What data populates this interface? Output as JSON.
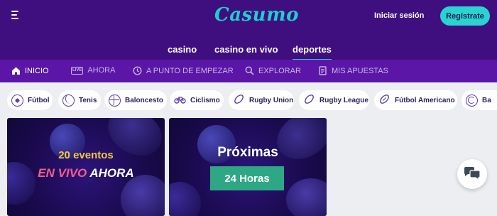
{
  "header": {
    "logo": "Casumo",
    "login_label": "Iniciar sesión",
    "register_label": "Regístrate"
  },
  "main_tabs": [
    {
      "label": "casino",
      "active": false
    },
    {
      "label": "casino en vivo",
      "active": false
    },
    {
      "label": "deportes",
      "active": true
    }
  ],
  "subnav": [
    {
      "label": "INICIO",
      "icon": "home-icon",
      "active": true
    },
    {
      "label": "AHORA",
      "icon": "live-icon",
      "active": false
    },
    {
      "label": "A PUNTO DE EMPEZAR",
      "icon": "clock-icon",
      "active": false
    },
    {
      "label": "EXPLORAR",
      "icon": "search-icon",
      "active": false
    },
    {
      "label": "MIS APUESTAS",
      "icon": "betslip-icon",
      "active": false
    }
  ],
  "subnav_live_badge": "LIVE",
  "sports": [
    {
      "label": "Fútbol",
      "icon": "soccer-ball-icon"
    },
    {
      "label": "Tenis",
      "icon": "tennis-ball-icon"
    },
    {
      "label": "Baloncesto",
      "icon": "basketball-icon"
    },
    {
      "label": "Ciclismo",
      "icon": "bicycle-icon"
    },
    {
      "label": "Rugby Union",
      "icon": "rugby-ball-icon"
    },
    {
      "label": "Rugby League",
      "icon": "rugby-ball-icon"
    },
    {
      "label": "Fútbol Americano",
      "icon": "american-football-icon"
    },
    {
      "label": "Ba",
      "icon": "volleyball-icon"
    }
  ],
  "cards": {
    "live": {
      "line1": "20 eventos",
      "line2a": "EN VIVO",
      "line2b": "AHORA"
    },
    "upcoming": {
      "line1": "Próximas",
      "badge": "24 Horas"
    }
  },
  "colors": {
    "header_bg": "#3f0f7f",
    "subnav_bg": "#5b16a8",
    "accent": "#2ad2d2",
    "badge_green": "#2ea884",
    "live_yellow": "#f5c542",
    "live_pink": "#ff5b8a"
  }
}
